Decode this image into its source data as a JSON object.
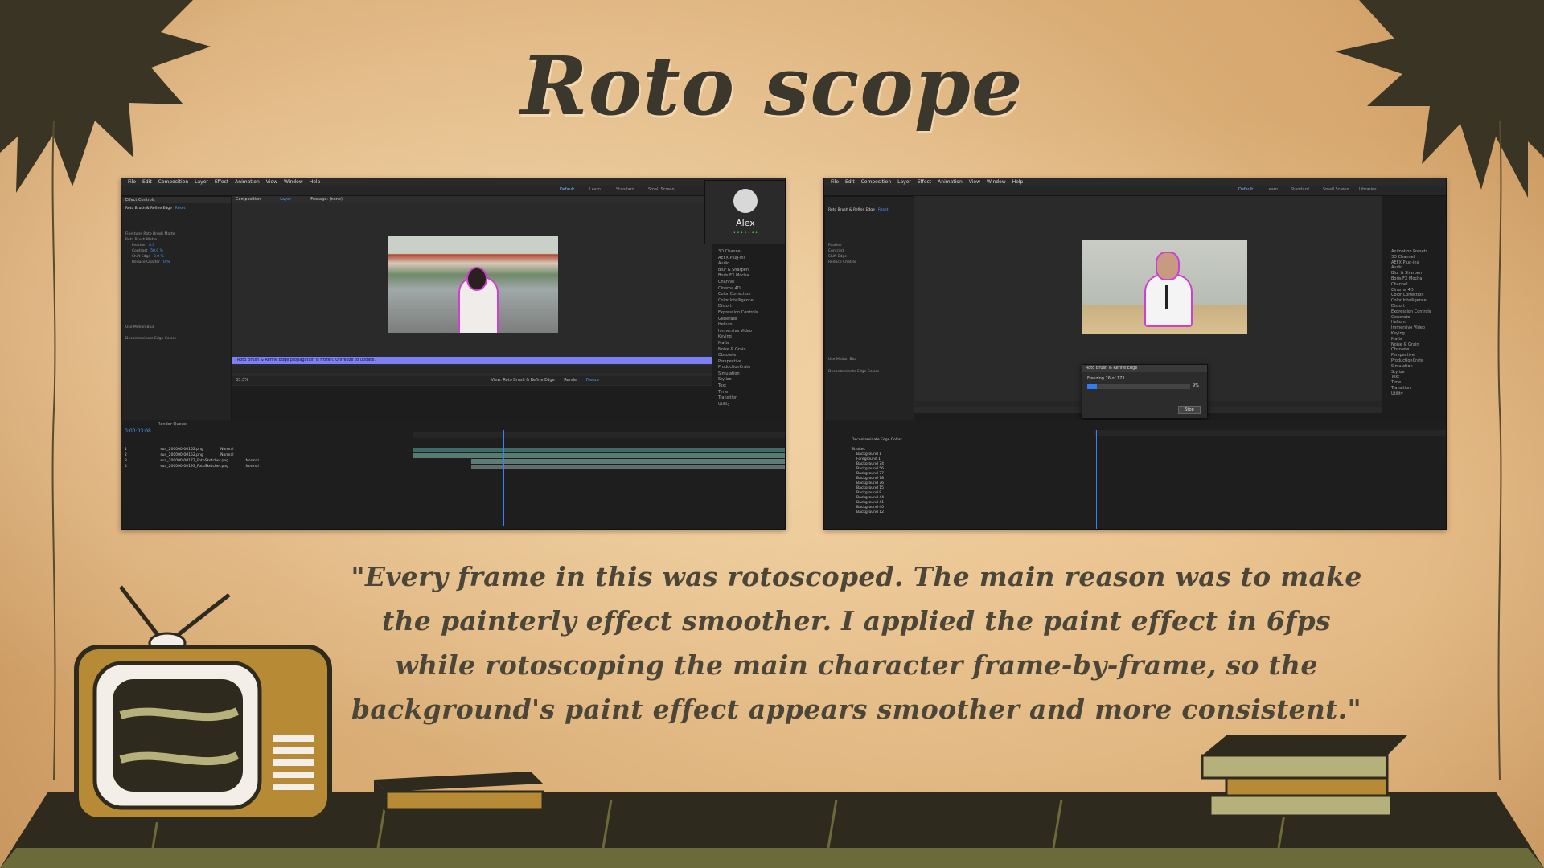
{
  "slide": {
    "title": "Roto scope",
    "quote": "\"Every frame in this was rotoscoped. The main reason was to make the painterly effect smoother. I applied the paint effect  in 6fps  while rotoscoping the main character frame-by-frame, so the background's paint effect appears smoother and more consistent.\""
  },
  "left_screenshot": {
    "menu": [
      "File",
      "Edit",
      "Composition",
      "Layer",
      "Effect",
      "Animation",
      "View",
      "Window",
      "Help"
    ],
    "workspaces": [
      "Default",
      "Learn",
      "Standard",
      "Small Screen",
      "Libraries"
    ],
    "effect_controls_tab": "Effect Controls",
    "effect_name": "Roto Brush & Refine Edge",
    "effect_reset": "Reset",
    "properties": [
      {
        "name": "Fine-tune Roto Brush Matte",
        "value": ""
      },
      {
        "name": "Roto Brush Matte",
        "value": ""
      },
      {
        "name": "Feather",
        "value": "0.0"
      },
      {
        "name": "Contrast",
        "value": "50.0 %"
      },
      {
        "name": "Shift Edge",
        "value": "0.0 %"
      },
      {
        "name": "Reduce Chatter",
        "value": "0 %"
      },
      {
        "name": "Use Motion Blur",
        "value": ""
      },
      {
        "name": "Decontaminate Edge Colors",
        "value": ""
      }
    ],
    "viewer_tabs": [
      "Composition",
      "Layer",
      "Footage: (none)"
    ],
    "status_text": "Roto Brush & Refine Edge propagation is frozen. Unfreeze to update.",
    "user_name": "Alex",
    "user_status": "• • • • • • •",
    "effects_list": [
      "3D Channel",
      "AEFX Plug-ins",
      "Audio",
      "Blur & Sharpen",
      "Boris FX Mocha",
      "Channel",
      "Cinema 4D",
      "Color Correction",
      "Color Intelligence",
      "Distort",
      "Expression Controls",
      "Generate",
      "Helium",
      "Immersive Video",
      "Keying",
      "Matte",
      "Noise & Grain",
      "Obsolete",
      "Perspective",
      "ProductionCrate",
      "Simulation",
      "Stylize",
      "Text",
      "Time",
      "Transition",
      "Utility"
    ],
    "timecode": "0:00:03:08",
    "zoom": "33.3%",
    "view_label": "View:",
    "view_value": "Roto Brush & Refine Edge",
    "render_label": "Render",
    "freeze_label": "Freeze",
    "layers": [
      {
        "num": "1",
        "name": "sun_200000-00152.png",
        "mode": "Normal"
      },
      {
        "num": "2",
        "name": "sun_200000-00152.png",
        "mode": "Normal"
      },
      {
        "num": "3",
        "name": "sun_200000-00177_FotoSketcher.png",
        "mode": "Normal"
      },
      {
        "num": "4",
        "name": "sun_200000-00193_FotoSketcher.png",
        "mode": "Normal"
      }
    ],
    "render_queue_tab": "Render Queue"
  },
  "right_screenshot": {
    "menu": [
      "File",
      "Edit",
      "Composition",
      "Layer",
      "Effect",
      "Animation",
      "View",
      "Window",
      "Help"
    ],
    "workspaces": [
      "Default",
      "Learn",
      "Standard",
      "Small Screen",
      "Libraries"
    ],
    "effect_name": "Roto Brush & Refine Edge",
    "effect_reset": "Reset",
    "dialog_title": "Roto Brush & Refine Edge",
    "dialog_text": "Freezing 16 of 173...",
    "dialog_percent": "9%",
    "dialog_button": "Stop",
    "properties": [
      "Feather",
      "Contrast",
      "Shift Edge",
      "Reduce Chatter",
      "Use Motion Blur",
      "Decontaminate Edge Colors"
    ],
    "layers": [
      "Decontaminate Edge Colors",
      "Strokes",
      "Background 1",
      "Foreground 1",
      "Background 74",
      "Background 56",
      "Background 77",
      "Background 78",
      "Background 76",
      "Background 15",
      "Background 8",
      "Background 44",
      "Background 41",
      "Background 40",
      "Background 12"
    ],
    "effects_list": [
      "Animation Presets",
      "3D Channel",
      "AEFX Plug-ins",
      "Audio",
      "Blur & Sharpen",
      "Boris FX Mocha",
      "Channel",
      "Cinema 4D",
      "Color Correction",
      "Color Intelligence",
      "Distort",
      "Expression Controls",
      "Generate",
      "Helium",
      "Immersive Video",
      "Keying",
      "Matte",
      "Noise & Grain",
      "Obsolete",
      "Perspective",
      "ProductionCrate",
      "Simulation",
      "Stylize",
      "Text",
      "Time",
      "Transition",
      "Utility"
    ]
  },
  "colors": {
    "title": "#3b372c",
    "quote": "#4b4638",
    "paper": "#e2bd8c",
    "ink": "#2e2a1e",
    "accent_blue": "#4d9dff",
    "olive": "#6b6a3a"
  },
  "decorations": [
    "starburst-top-left",
    "starburst-top-right",
    "retro-tv",
    "shelf",
    "stacked-books",
    "vine-border"
  ]
}
